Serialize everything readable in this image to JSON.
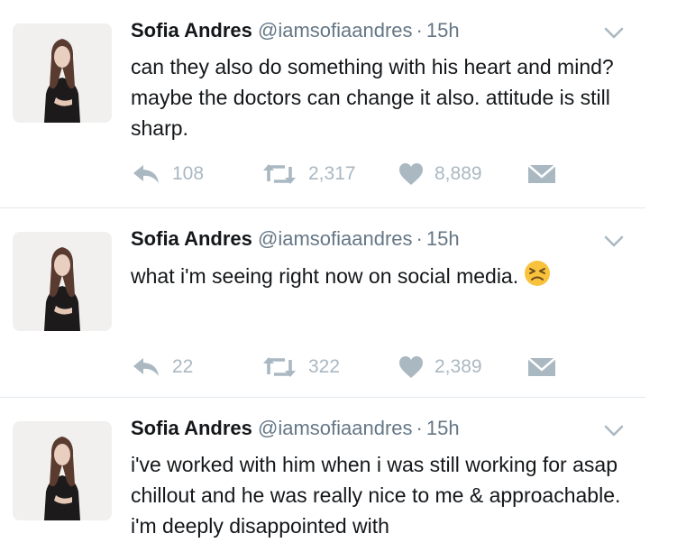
{
  "tweets": [
    {
      "author": "Sofia Andres",
      "handle": "@iamsofiaandres",
      "separator": "·",
      "time": "15h",
      "text": "can they also do something with his heart and mind? maybe the doctors can change it also. attitude is still sharp.",
      "replies": "108",
      "retweets": "2,317",
      "likes": "8,889"
    },
    {
      "author": "Sofia Andres",
      "handle": "@iamsofiaandres",
      "separator": "·",
      "time": "15h",
      "text": "what i'm seeing right now on social media.",
      "emoji": "persevering-face-emoji",
      "replies": "22",
      "retweets": "322",
      "likes": "2,389"
    },
    {
      "author": "Sofia Andres",
      "handle": "@iamsofiaandres",
      "separator": "·",
      "time": "15h",
      "text": "i've worked with him when i was still working for asap chillout and he was really nice to me & approachable. i'm deeply disappointed with"
    }
  ],
  "colors": {
    "name": "#14171a",
    "meta": "#657786",
    "action": "#aab8c2",
    "divider": "#e1e8ed"
  },
  "icons": [
    "reply-icon",
    "retweet-icon",
    "like-icon",
    "direct-message-icon",
    "chevron-down-icon"
  ]
}
